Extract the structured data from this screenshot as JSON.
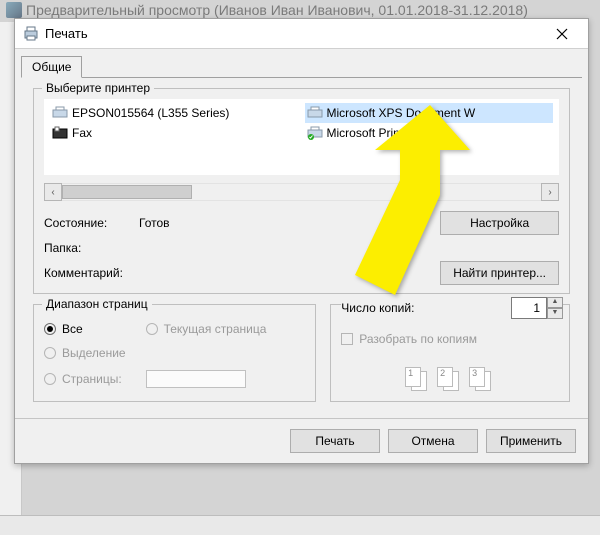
{
  "bg_window_title": "Предварительный просмотр (Иванов Иван Иванович, 01.01.2018-31.12.2018)",
  "dialog": {
    "title": "Печать",
    "tab_general": "Общие",
    "select_printer_legend": "Выберите принтер",
    "printers": [
      {
        "name": "EPSON015564 (L355 Series)",
        "selected": false,
        "icon": "printer"
      },
      {
        "name": "Microsoft XPS Document W",
        "selected": true,
        "icon": "printer"
      },
      {
        "name": "Fax",
        "selected": false,
        "icon": "fax"
      },
      {
        "name": "Microsoft Print to PDF",
        "selected": false,
        "icon": "printer-ok"
      }
    ],
    "status_label": "Состояние:",
    "status_value": "Готов",
    "folder_label": "Папка:",
    "comment_label": "Комментарий:",
    "btn_preferences": "Настройка",
    "btn_find": "Найти принтер...",
    "range_legend": "Диапазон страниц",
    "range_all": "Все",
    "range_current": "Текущая страница",
    "range_selection": "Выделение",
    "range_pages": "Страницы:",
    "copies_legend": "Число копий:",
    "copies_value": "1",
    "collate_label": "Разобрать по копиям",
    "btn_print": "Печать",
    "btn_cancel": "Отмена",
    "btn_apply": "Применить"
  }
}
